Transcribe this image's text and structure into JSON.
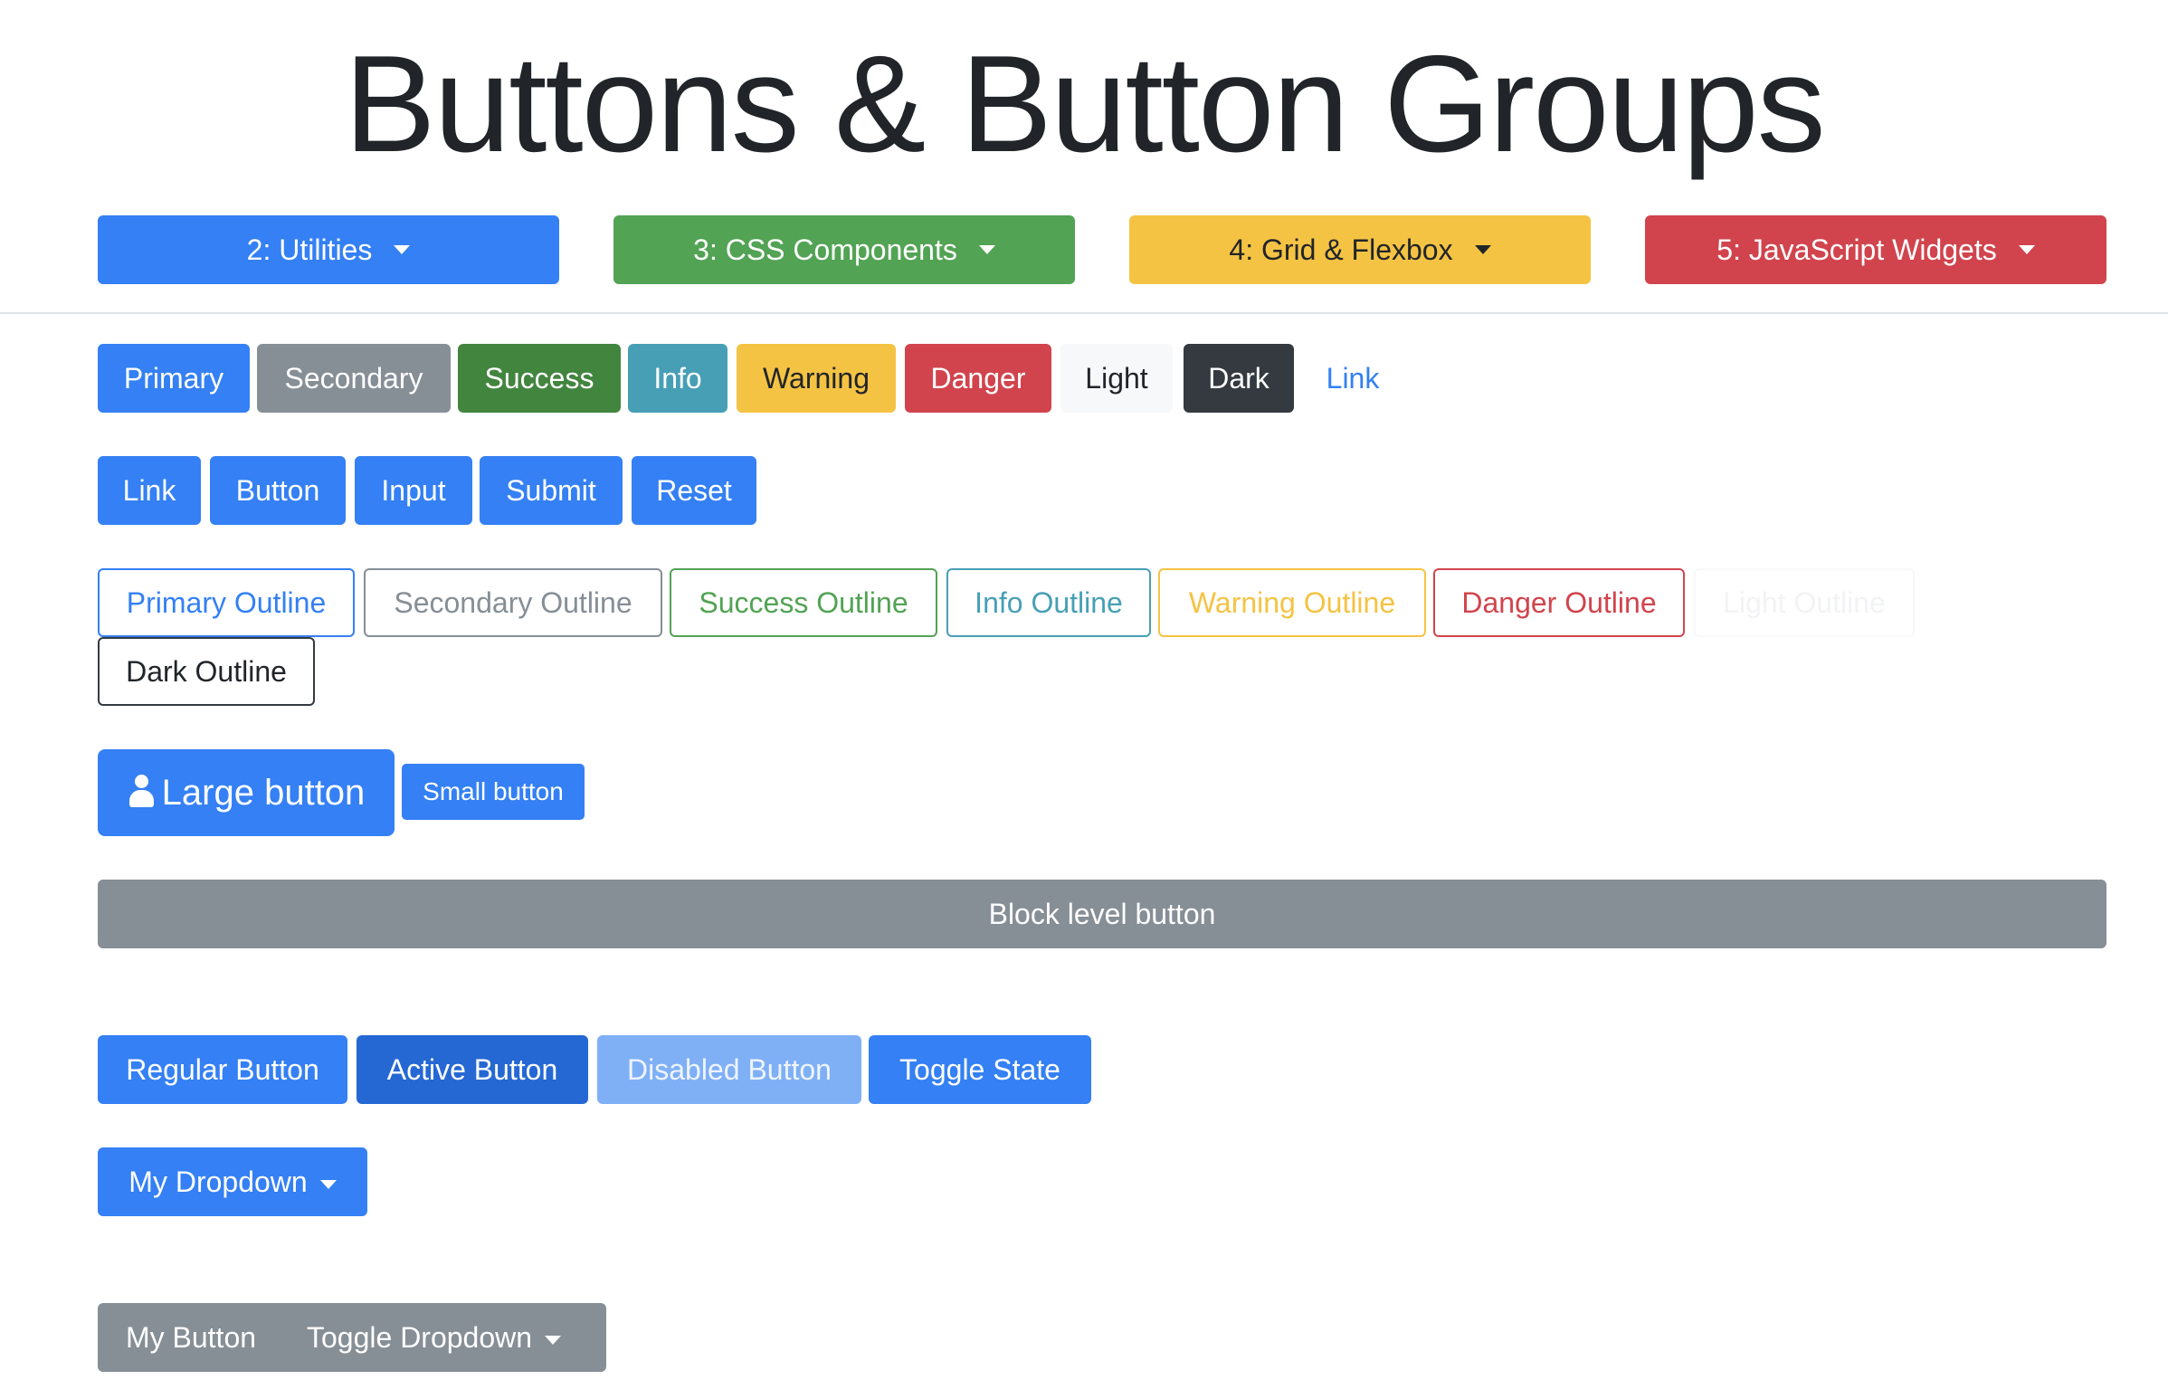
{
  "page": {
    "title": "Buttons & Button Groups"
  },
  "nav": {
    "items": [
      {
        "label": "2: Utilities",
        "color": "#3480f4"
      },
      {
        "label": "3: CSS Components",
        "color": "#52a354"
      },
      {
        "label": "4: Grid & Flexbox",
        "color": "#f5c343"
      },
      {
        "label": "5: JavaScript Widgets",
        "color": "#d1444d"
      }
    ]
  },
  "variants": {
    "primary": "Primary",
    "secondary": "Secondary",
    "success": "Success",
    "info": "Info",
    "warning": "Warning",
    "danger": "Danger",
    "light": "Light",
    "dark": "Dark",
    "link": "Link"
  },
  "elements": {
    "link": "Link",
    "button": "Button",
    "input": "Input",
    "submit": "Submit",
    "reset": "Reset"
  },
  "outlines": {
    "primary": "Primary Outline",
    "secondary": "Secondary Outline",
    "success": "Success Outline",
    "info": "Info Outline",
    "warning": "Warning Outline",
    "danger": "Danger Outline",
    "light": "Light Outline",
    "dark": "Dark Outline"
  },
  "sizes": {
    "large": "Large button",
    "large_icon": "user-icon",
    "small": "Small button"
  },
  "block": {
    "label": "Block level button"
  },
  "states": {
    "regular": "Regular Button",
    "active": "Active Button",
    "disabled": "Disabled Button",
    "toggle": "Toggle State"
  },
  "dropdown": {
    "label": "My Dropdown"
  },
  "split": {
    "button": "My Button",
    "toggle": "Toggle Dropdown"
  },
  "colors": {
    "primary": "#3480f4",
    "primary_active": "#2568d4",
    "primary_disabled": "#7fb0f6",
    "secondary": "#868e96",
    "success": "#42853f",
    "info": "#479fb6",
    "warning": "#f5c343",
    "danger": "#d1444d",
    "light": "#f7f8f9",
    "dark": "#343a40",
    "outline_success": "#52a354"
  }
}
